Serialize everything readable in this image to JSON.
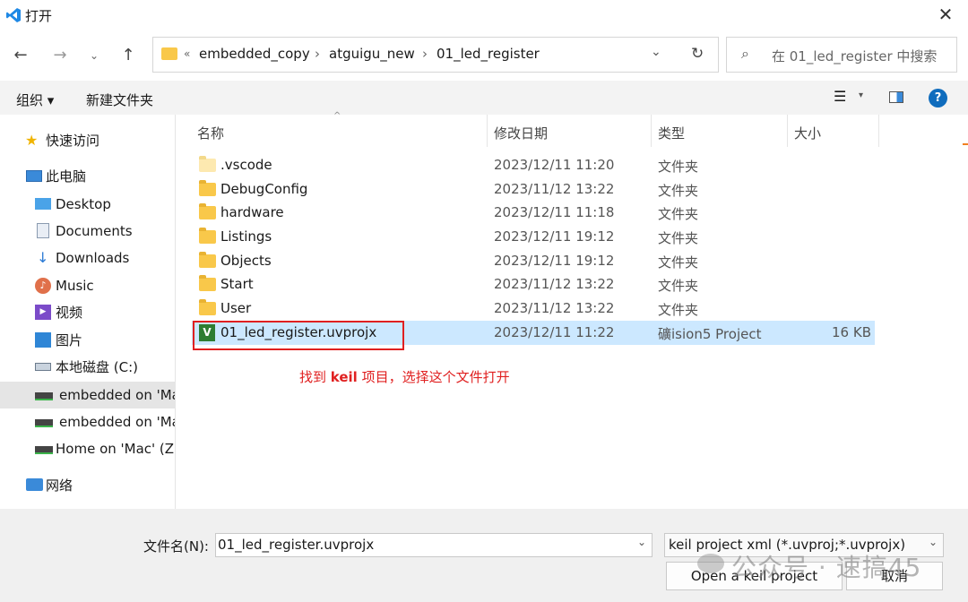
{
  "window": {
    "title": "打开",
    "close_glyph": "✕"
  },
  "address": {
    "overflow": "«",
    "crumbs": [
      "embedded_copy",
      "atguigu_new",
      "01_led_register"
    ],
    "separator": "›"
  },
  "search": {
    "placeholder": "在 01_led_register 中搜索"
  },
  "toolbar": {
    "organize": "组织 ▾",
    "new_folder": "新建文件夹"
  },
  "sidebar": {
    "items": [
      {
        "label": "快速访问",
        "icon": "star-icon"
      },
      {
        "label": "此电脑",
        "icon": "computer-icon"
      },
      {
        "label": "Desktop",
        "icon": "desktop-icon"
      },
      {
        "label": "Documents",
        "icon": "documents-icon"
      },
      {
        "label": "Downloads",
        "icon": "download-icon"
      },
      {
        "label": "Music",
        "icon": "music-icon"
      },
      {
        "label": "视频",
        "icon": "video-icon"
      },
      {
        "label": "图片",
        "icon": "pictures-icon"
      },
      {
        "label": "本地磁盘 (C:)",
        "icon": "drive-icon"
      },
      {
        "label": "embedded on 'Ma",
        "icon": "network-drive-icon"
      },
      {
        "label": "embedded on 'Ma",
        "icon": "network-drive-icon"
      },
      {
        "label": "Home on 'Mac' (Z:",
        "icon": "network-drive-icon"
      },
      {
        "label": "网络",
        "icon": "network-icon"
      }
    ]
  },
  "columns": {
    "name": "名称",
    "modified": "修改日期",
    "type": "类型",
    "size": "大小"
  },
  "files": [
    {
      "name": ".vscode",
      "modified": "2023/12/11 11:20",
      "type": "文件夹",
      "size": ""
    },
    {
      "name": "DebugConfig",
      "modified": "2023/11/12 13:22",
      "type": "文件夹",
      "size": ""
    },
    {
      "name": "hardware",
      "modified": "2023/12/11 11:18",
      "type": "文件夹",
      "size": ""
    },
    {
      "name": "Listings",
      "modified": "2023/12/11 19:12",
      "type": "文件夹",
      "size": ""
    },
    {
      "name": "Objects",
      "modified": "2023/12/11 19:12",
      "type": "文件夹",
      "size": ""
    },
    {
      "name": "Start",
      "modified": "2023/11/12 13:22",
      "type": "文件夹",
      "size": ""
    },
    {
      "name": "User",
      "modified": "2023/11/12 13:22",
      "type": "文件夹",
      "size": ""
    },
    {
      "name": "01_led_register.uvprojx",
      "modified": "2023/12/11 11:22",
      "type": "礦ision5 Project",
      "size": "16 KB"
    }
  ],
  "annotation": {
    "prefix": "找到 ",
    "bold": "keil",
    "suffix": " 项目，选择这个文件打开",
    "color": "#e02020"
  },
  "bottom": {
    "filename_label": "文件名(N):",
    "filename_value": "01_led_register.uvprojx",
    "filter_value": "keil project xml (*.uvproj;*.uvprojx)",
    "open_button": "Open a keil project",
    "cancel_button": "取消"
  },
  "watermark": {
    "text": "公众号 · 速搞45"
  },
  "colors": {
    "accent": "#0067c0",
    "selection": "#cce8ff",
    "highlight_box": "#e02020"
  }
}
